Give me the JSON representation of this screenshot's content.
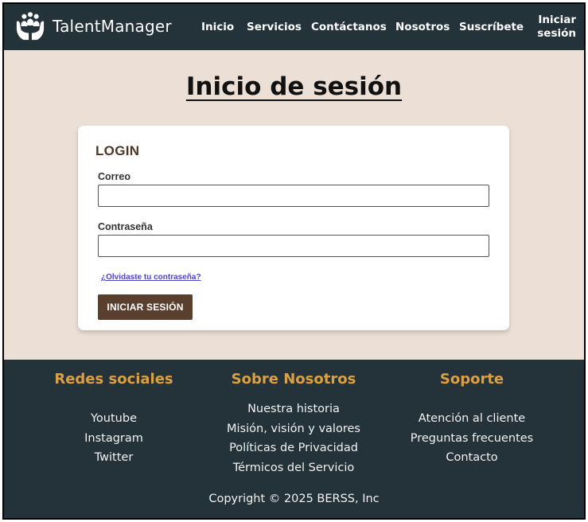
{
  "header": {
    "brand_name": "TalentManager",
    "nav": [
      "Inicio",
      "Servicios",
      "Contáctanos",
      "Nosotros",
      "Suscríbete"
    ],
    "login_line1": "Iniciar",
    "login_line2": "sesión"
  },
  "main": {
    "title": "Inicio de sesión"
  },
  "login_card": {
    "title": "LOGIN",
    "email_label": "Correo",
    "email_value": "",
    "password_label": "Contraseña",
    "password_value": "",
    "forgot_link": "¿Olvidaste tu contraseña?",
    "submit_label": "INICIAR SESIÓN"
  },
  "footer": {
    "social": {
      "heading": "Redes sociales",
      "links": [
        "Youtube",
        "Instagram",
        "Twitter"
      ]
    },
    "about": {
      "heading": "Sobre Nosotros",
      "links": [
        "Nuestra historia",
        "Misión, visión y valores",
        "Políticas de Privacidad",
        "Térmicos del Servicio"
      ]
    },
    "support": {
      "heading": "Soporte",
      "links": [
        "Atención al cliente",
        "Preguntas frecuentes",
        "Contacto"
      ]
    },
    "copyright": "Copyright © 2025 BERSS, Inc"
  },
  "colors": {
    "dark": "#243239",
    "background": "#ece0d6",
    "accent_brown": "#5a3f2e",
    "footer_heading": "#dba043",
    "link": "#4a46c9"
  },
  "icons": {
    "logo": "people-in-hands-icon"
  }
}
